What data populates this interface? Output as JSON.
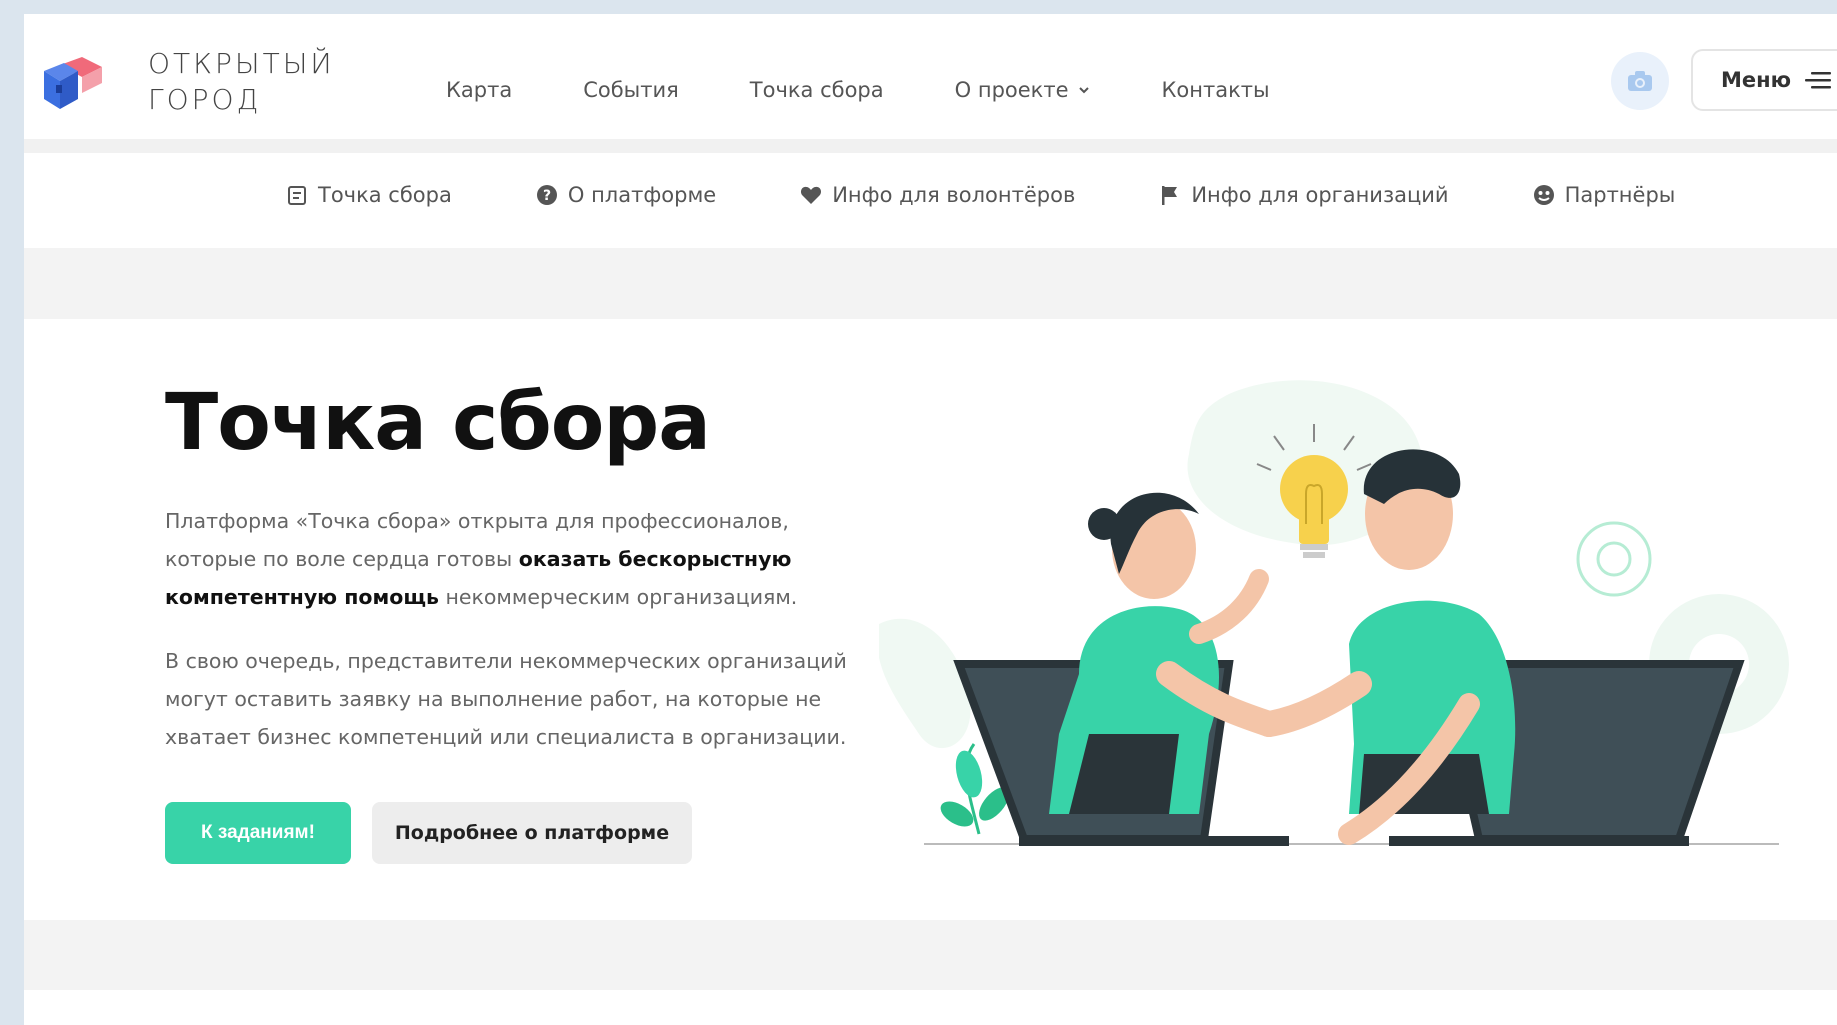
{
  "header": {
    "logo_line1": "ОТКРЫТЫЙ",
    "logo_line2": "ГОРОД",
    "nav": [
      {
        "label": "Карта"
      },
      {
        "label": "События"
      },
      {
        "label": "Точка сбора"
      },
      {
        "label": "О проекте"
      },
      {
        "label": "Контакты"
      }
    ],
    "menu_label": "Меню"
  },
  "subnav": [
    {
      "label": "Точка сбора",
      "icon": "document-icon"
    },
    {
      "label": "О платформе",
      "icon": "question-icon"
    },
    {
      "label": "Инфо для волонтёров",
      "icon": "heart-icon"
    },
    {
      "label": "Инфо для организаций",
      "icon": "flag-icon"
    },
    {
      "label": "Партнёры",
      "icon": "handshake-icon"
    }
  ],
  "hero": {
    "title": "Точка сбора",
    "p1_a": "Платформа «Точка сбора» открыта для профессионалов, которые по воле сердца готовы ",
    "p1_b": "оказать бескорыстную компетентную помощь",
    "p1_c": " некоммерческим организациям.",
    "p2": "В свою очередь, представители некоммерческих организаций могут оставить заявку на выполнение работ, на которые не хватает бизнес компетенций или специалиста в организации.",
    "btn_primary": "К заданиям!",
    "btn_secondary": "Подробнее о платформе"
  },
  "colors": {
    "accent": "#38d3a8",
    "logo_blue": "#3b6fe0",
    "logo_pink": "#f06a7a"
  }
}
